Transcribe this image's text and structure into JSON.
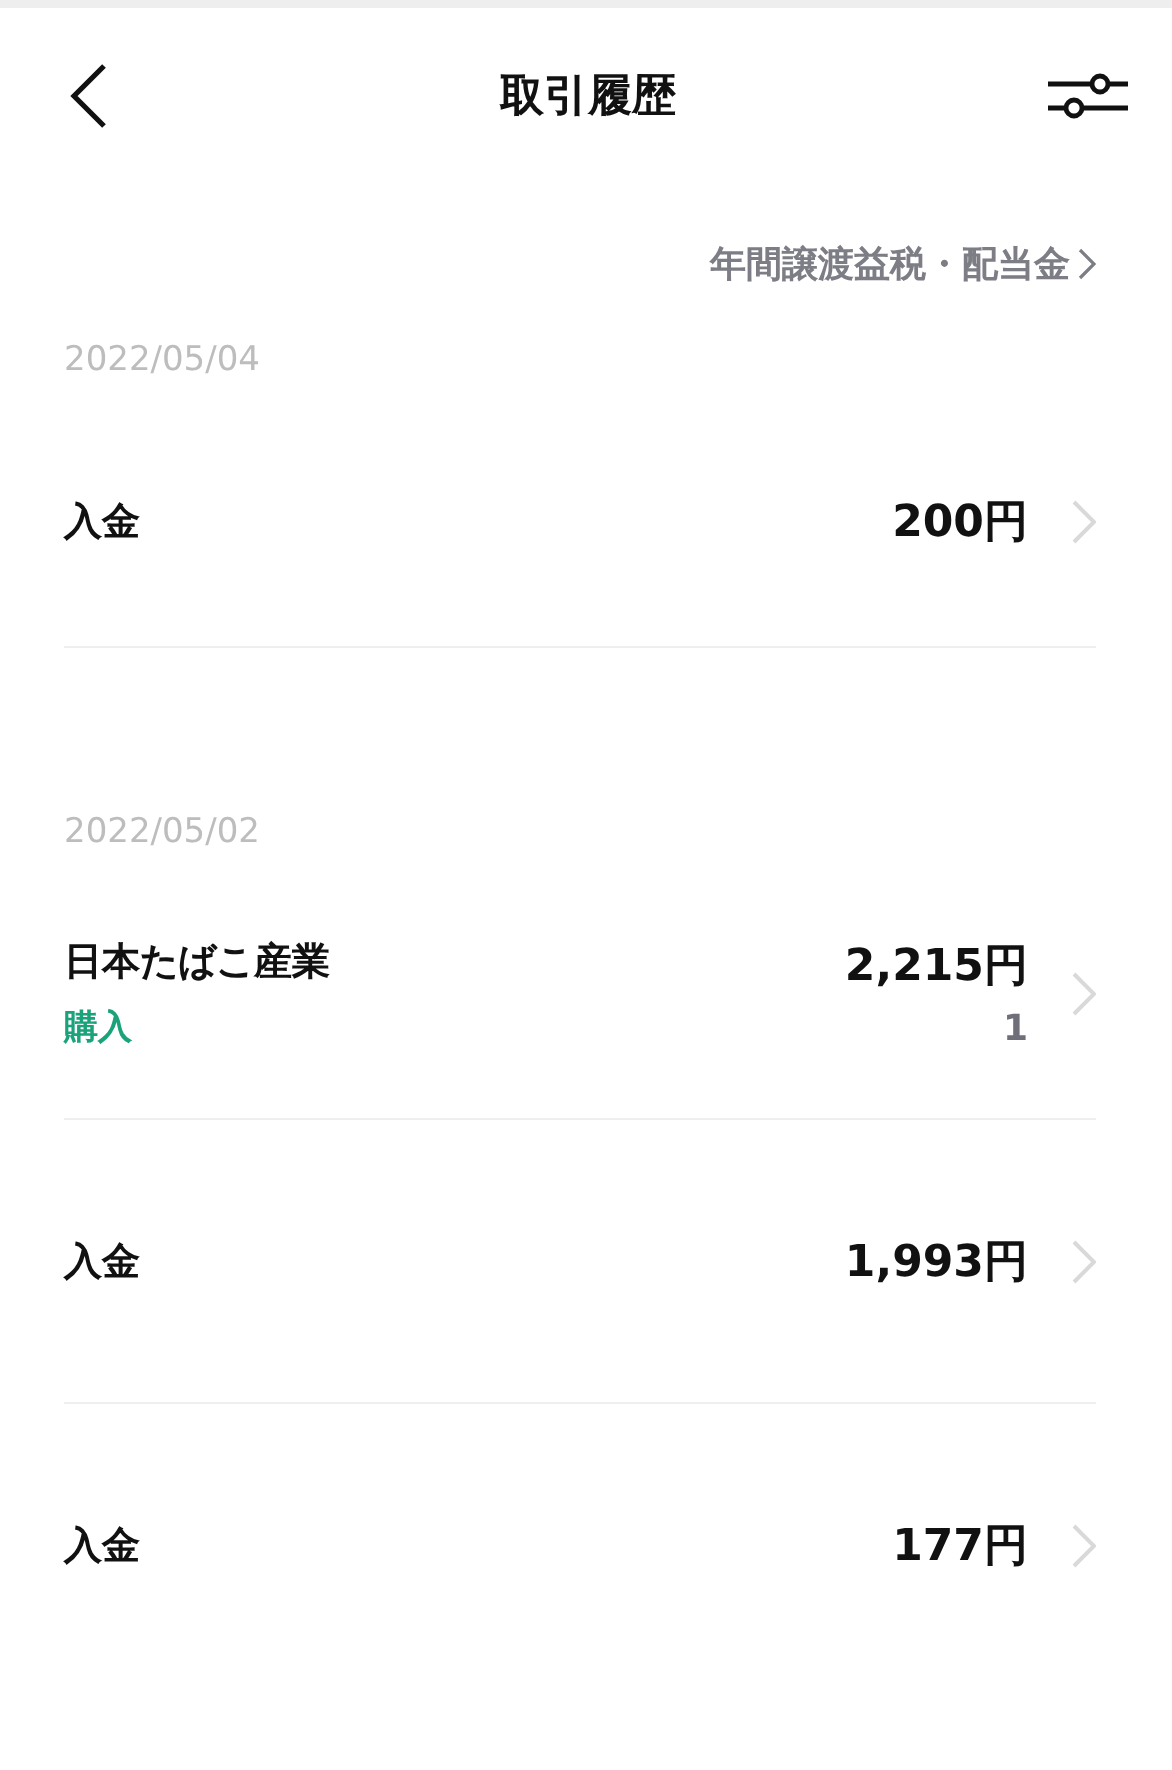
{
  "header": {
    "title": "取引履歴"
  },
  "tax_link": "年間譲渡益税・配当金",
  "sections": [
    {
      "date": "2022/05/04",
      "transactions": [
        {
          "name": "入金",
          "amount": "200円"
        }
      ]
    },
    {
      "date": "2022/05/02",
      "transactions": [
        {
          "name": "日本たばこ産業",
          "amount": "2,215円",
          "type": "購入",
          "quantity": "1"
        },
        {
          "name": "入金",
          "amount": "1,993円"
        },
        {
          "name": "入金",
          "amount": "177円"
        }
      ]
    }
  ]
}
